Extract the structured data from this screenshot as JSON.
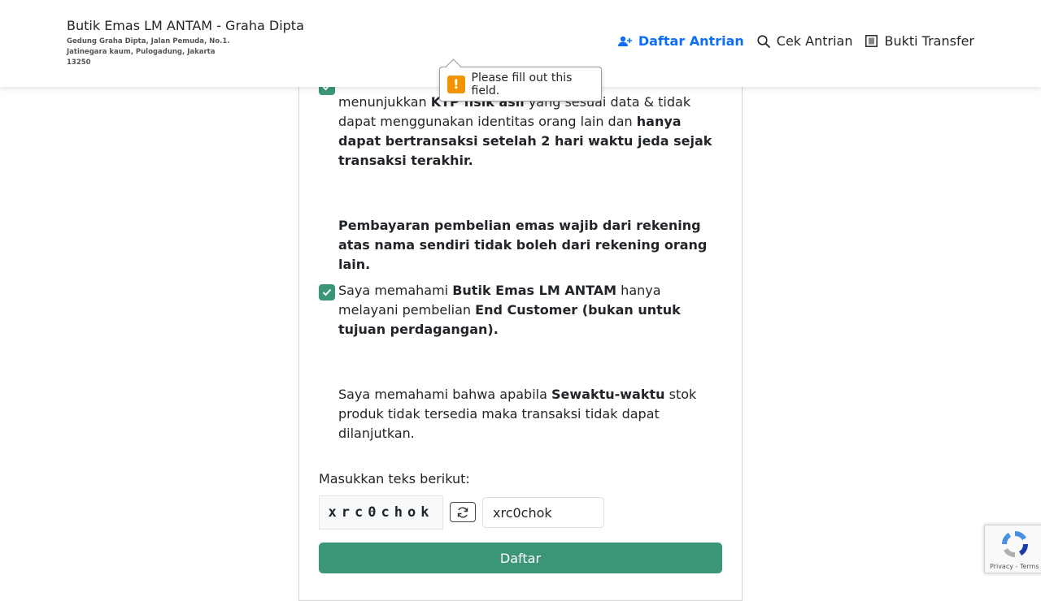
{
  "header": {
    "title": "Butik Emas LM ANTAM - Graha Dipta",
    "address": "Gedung Graha Dipta, Jalan Pemuda, No.1. Jatinegara kaum, Pulogadung, Jakarta 13250",
    "nav": [
      {
        "label": "Daftar Antrian",
        "icon": "person-add-icon"
      },
      {
        "label": "Cek Antrian",
        "icon": "search-icon"
      },
      {
        "label": "Bukti Transfer",
        "icon": "receipt-icon"
      }
    ]
  },
  "tooltip": {
    "message": "Please fill out this field."
  },
  "terms": {
    "item1": {
      "line_prefix": "menunjukkan",
      "strong1": "KTP fisik asli",
      "text1": "yang sesuai data & tidak dapat menggunakan identitas orang lain dan",
      "strong2": "hanya dapat bertransaksi setelah 2 hari waktu jeda sejak transaksi terakhir."
    },
    "item2": {
      "strong": "Pembayaran pembelian emas wajib dari rekening atas nama sendiri tidak boleh dari rekening orang lain."
    },
    "item3": {
      "text1": "Saya memahami",
      "strong1": "Butik Emas LM  ANTAM",
      "text2": "hanya melayani pembelian",
      "strong2": "End  Customer (bukan untuk tujuan perdagangan)."
    },
    "item4": {
      "text1": "Saya memahami bahwa apabila",
      "strong1": "Sewaktu-waktu",
      "text2": "stok produk tidak tersedia maka transaksi tidak dapat dilanjutkan."
    }
  },
  "captcha": {
    "label": "Masukkan teks berikut:",
    "code": "xrc0chok",
    "input_value": "xrc0chok"
  },
  "submit_label": "Daftar",
  "recaptcha": {
    "footer": "Privacy - Terms"
  },
  "colors": {
    "accent": "#0d6efd",
    "success": "#3a9676",
    "warning": "#f29400"
  }
}
